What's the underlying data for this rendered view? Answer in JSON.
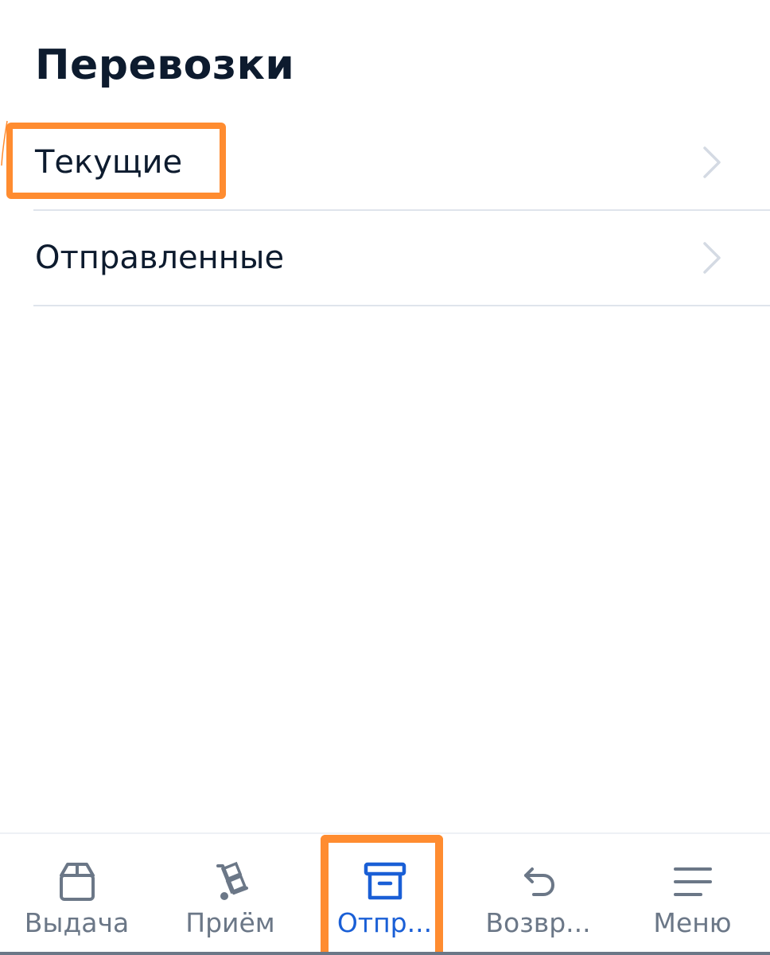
{
  "header": {
    "title": "Перевозки"
  },
  "list": {
    "items": [
      {
        "label": "Текущие",
        "icon": "chevron-right-icon"
      },
      {
        "label": "Отправленные",
        "icon": "chevron-right-icon"
      }
    ]
  },
  "tabbar": {
    "active": "Отпр...",
    "tabs": [
      {
        "label": "Выдача",
        "icon": "box-icon"
      },
      {
        "label": "Приём",
        "icon": "hand-truck-icon"
      },
      {
        "label": "Отпр...",
        "icon": "archive-box-icon"
      },
      {
        "label": "Возвр...",
        "icon": "return-arrow-icon"
      },
      {
        "label": "Меню",
        "icon": "hamburger-menu-icon"
      }
    ]
  },
  "colors": {
    "title_text": "#0d1b2e",
    "tab_inactive": "#6b7787",
    "tab_active": "#1a5fd6",
    "highlight": "#ff8c30",
    "divider": "#dfe4ec"
  }
}
